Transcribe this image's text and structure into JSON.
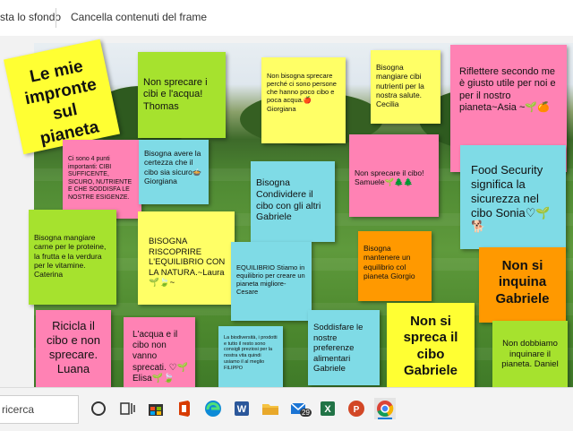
{
  "toolbar": {
    "item1": "sta lo sfondo",
    "item2": "Cancella contenuti del frame"
  },
  "notes": [
    {
      "text": "Le mie impronte sul pianeta",
      "color": "#ffff33"
    },
    {
      "text": "Non sprecare i cibi e l'acqua! Thomas",
      "color": "#a6e22e"
    },
    {
      "text": "Non bisogna sprecare perché ci sono persone che hanno poco cibo e poca acqua.🍎 Giorgiana",
      "color": "#ffff66"
    },
    {
      "text": "Bisogna mangiare cibi nutrienti per la nostra salute. Cecilia",
      "color": "#ffff66"
    },
    {
      "text": "Riflettere secondo me è giusto utile per noi e per il nostro pianeta~Asia ~🌱🍊",
      "color": "#ff82b4"
    },
    {
      "text": "Ci sono 4 punti importanti: CIBI SUFFICENTE, SICURO, NUTRIENTE E CHE SODDISFA LE NOSTRE ESIGENZE.",
      "color": "#ff82b4"
    },
    {
      "text": "Bisogna avere la certezza che il cibo sia sicuro🍲 Giorgiana",
      "color": "#7fdbe6"
    },
    {
      "text": "Bisogna Condividere il cibo con gli altri Gabriele",
      "color": "#7fdbe6"
    },
    {
      "text": "Non sprecare il cibo! Samuele🌱🌲🌲",
      "color": "#ff82b4"
    },
    {
      "text": "Food Security significa la sicurezza nel cibo Sonia♡🌱🐕",
      "color": "#7fdbe6"
    },
    {
      "text": "Bisogna mangiare carne per le proteine, la frutta e la verdura per le vitamine. Caterina",
      "color": "#a6e22e"
    },
    {
      "text": "BISOGNA RISCOPRIRE L'EQUILIBRIO CON LA NATURA.~Laura 🌱🍃~",
      "color": "#ffff66"
    },
    {
      "text": "EQUILIBRIO Stiamo in equilibrio per creare un pianeta migliore-Cesare",
      "color": "#7fdbe6"
    },
    {
      "text": "Bisogna mantenere un equilibrio col pianeta Giorgio",
      "color": "#ff9900"
    },
    {
      "text": "Non si inquina Gabriele",
      "color": "#ff9900"
    },
    {
      "text": "Ricicla il cibo e non sprecare. Luana",
      "color": "#ff82b4"
    },
    {
      "text": "L'acqua e il cibo non vanno sprecati. ♡🌱Elisa🌱🍃",
      "color": "#ff82b4"
    },
    {
      "text": "La biodiversità, i prodotti e tutto il resto sono consigli preziosi per la nostra vita quindi usiamo il al meglio FILIPPO",
      "color": "#7fdbe6"
    },
    {
      "text": "Soddisfare le nostre preferenze alimentari Gabriele",
      "color": "#7fdbe6"
    },
    {
      "text": "Non si spreca il cibo Gabriele",
      "color": "#ffff33"
    },
    {
      "text": "Non dobbiamo inquinare il pianeta. Daniel",
      "color": "#a6e22e"
    }
  ],
  "taskbar": {
    "search_label": "ricerca",
    "icons": [
      "cortana-icon",
      "task-view-icon",
      "store-icon",
      "office-icon",
      "edge-icon",
      "word-icon",
      "file-explorer-icon",
      "mail-icon",
      "excel-icon",
      "powerpoint-icon",
      "chrome-icon"
    ],
    "mail_badge": "29"
  }
}
